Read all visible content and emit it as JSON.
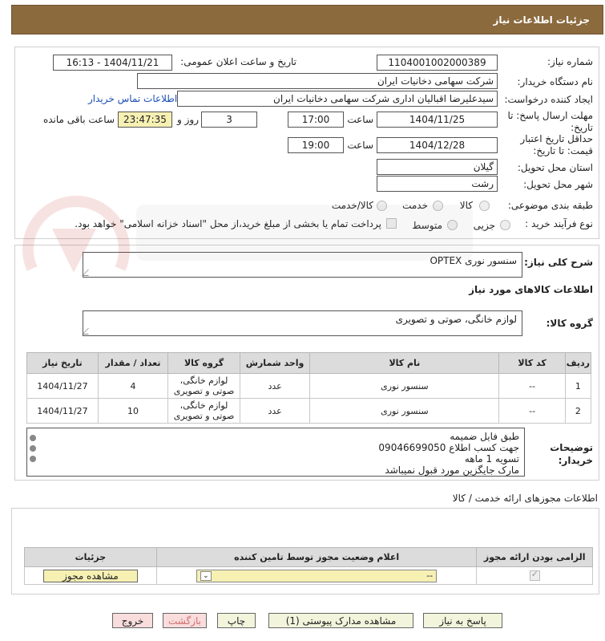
{
  "header": {
    "title": "جزئیات اطلاعات نیاز"
  },
  "info": {
    "need_number_label": "شماره نیاز:",
    "need_number": "1104001002000389",
    "announce_label": "تاریخ و ساعت اعلان عمومی:",
    "announce_value": "1404/11/21 - 16:13",
    "buyer_label": "نام دستگاه خریدار:",
    "buyer_value": "شرکت سهامی دخانیات ایران",
    "creator_label": "ایجاد کننده درخواست:",
    "creator_value": "سیدعلیرضا اقبالیان اداری شرکت سهامی دخانیات ایران",
    "contact_link": "اطلاعات تماس خریدار",
    "deadline_label_1": "مهلت ارسال پاسخ: تا",
    "deadline_label_2": "تاریخ:",
    "deadline_date": "1404/11/25",
    "time_label": "ساعت",
    "deadline_time": "17:00",
    "days_value": "3",
    "days_label": "روز و",
    "remaining_time": "23:47:35",
    "remaining_label": "ساعت باقی مانده",
    "validity_label_1": "حداقل تاریخ اعتبار",
    "validity_label_2": "قیمت: تا تاریخ:",
    "validity_date": "1404/12/28",
    "validity_time": "19:00",
    "province_label": "استان محل تحویل:",
    "province_value": "گیلان",
    "city_label": "شهر محل تحویل:",
    "city_value": "رشت",
    "category_label": "طبقه بندی موضوعی:",
    "category_options": [
      "کالا",
      "خدمت",
      "کالا/خدمت"
    ],
    "process_label": "نوع فرآیند خرید :",
    "process_options": [
      "جزیی",
      "متوسط"
    ],
    "payment_note": "پرداخت تمام یا بخشی از مبلغ خرید،از محل \"اسناد خزانه اسلامی\" خواهد بود."
  },
  "description": {
    "label": "شرح کلی نیاز:",
    "value": "سنسور نوری OPTEX",
    "goods_title": "اطلاعات کالاهای مورد نیاز",
    "group_label": "گروه کالا:",
    "group_value": "لوازم خانگی، صوتی و تصویری"
  },
  "goods_table": {
    "headers": [
      "ردیف",
      "کد کالا",
      "نام کالا",
      "واحد شمارش",
      "گروه کالا",
      "تعداد / مقدار",
      "تاریخ نیاز"
    ],
    "rows": [
      {
        "row": "1",
        "code": "--",
        "name": "سنسور نوری",
        "unit": "عدد",
        "group_1": "لوازم خانگی،",
        "group_2": "صوتی و تصویری",
        "qty": "4",
        "date": "1404/11/27"
      },
      {
        "row": "2",
        "code": "--",
        "name": "سنسور نوری",
        "unit": "عدد",
        "group_1": "لوازم خانگی،",
        "group_2": "صوتی و تصویری",
        "qty": "10",
        "date": "1404/11/27"
      }
    ]
  },
  "buyer_notes": {
    "label_1": "توضیحات",
    "label_2": "خریدار:",
    "lines": [
      "طبق فایل ضمیمه",
      "جهت کسب اطلاع 09046699050",
      "تسویه 1 ماهه",
      "مارک جایگزین مورد قبول نمیباشد"
    ]
  },
  "permits": {
    "title": "اطلاعات مجوزهای ارائه خدمت / کالا",
    "headers": [
      "الزامی بودن ارائه مجوز",
      "اعلام وضعیت مجوز توسط تامین کننده",
      "جزئیات"
    ],
    "select_value": "--",
    "view_button": "مشاهده مجوز"
  },
  "actions": {
    "reply": "پاسخ به نیاز",
    "attachments": "مشاهده مدارک پیوستی (1)",
    "print": "چاپ",
    "back": "بازگشت",
    "exit": "خروج"
  }
}
